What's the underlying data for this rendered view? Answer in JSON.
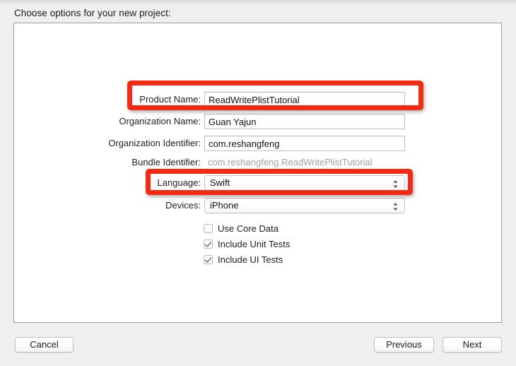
{
  "header": {
    "title": "Choose options for your new project:"
  },
  "form": {
    "rows": [
      {
        "label": "Product Name:",
        "value": "ReadWritePlistTutorial",
        "type": "text"
      },
      {
        "label": "Organization Name:",
        "value": "Guan Yajun",
        "type": "text"
      },
      {
        "label": "Organization Identifier:",
        "value": "com.reshangfeng",
        "type": "text"
      },
      {
        "label": "Bundle Identifier:",
        "value": "com.reshangfeng.ReadWritePlistTutorial",
        "type": "static"
      },
      {
        "label": "Language:",
        "value": "Swift",
        "type": "popup"
      },
      {
        "label": "Devices:",
        "value": "iPhone",
        "type": "popup"
      }
    ]
  },
  "checkboxes": [
    {
      "label": "Use Core Data",
      "checked": false
    },
    {
      "label": "Include Unit Tests",
      "checked": true
    },
    {
      "label": "Include UI Tests",
      "checked": true
    }
  ],
  "buttons": {
    "cancel": "Cancel",
    "previous": "Previous",
    "next": "Next"
  },
  "annotations": {
    "highlight_color": "#f62a12",
    "highlighted_fields": [
      "Product Name:",
      "Language:"
    ]
  }
}
